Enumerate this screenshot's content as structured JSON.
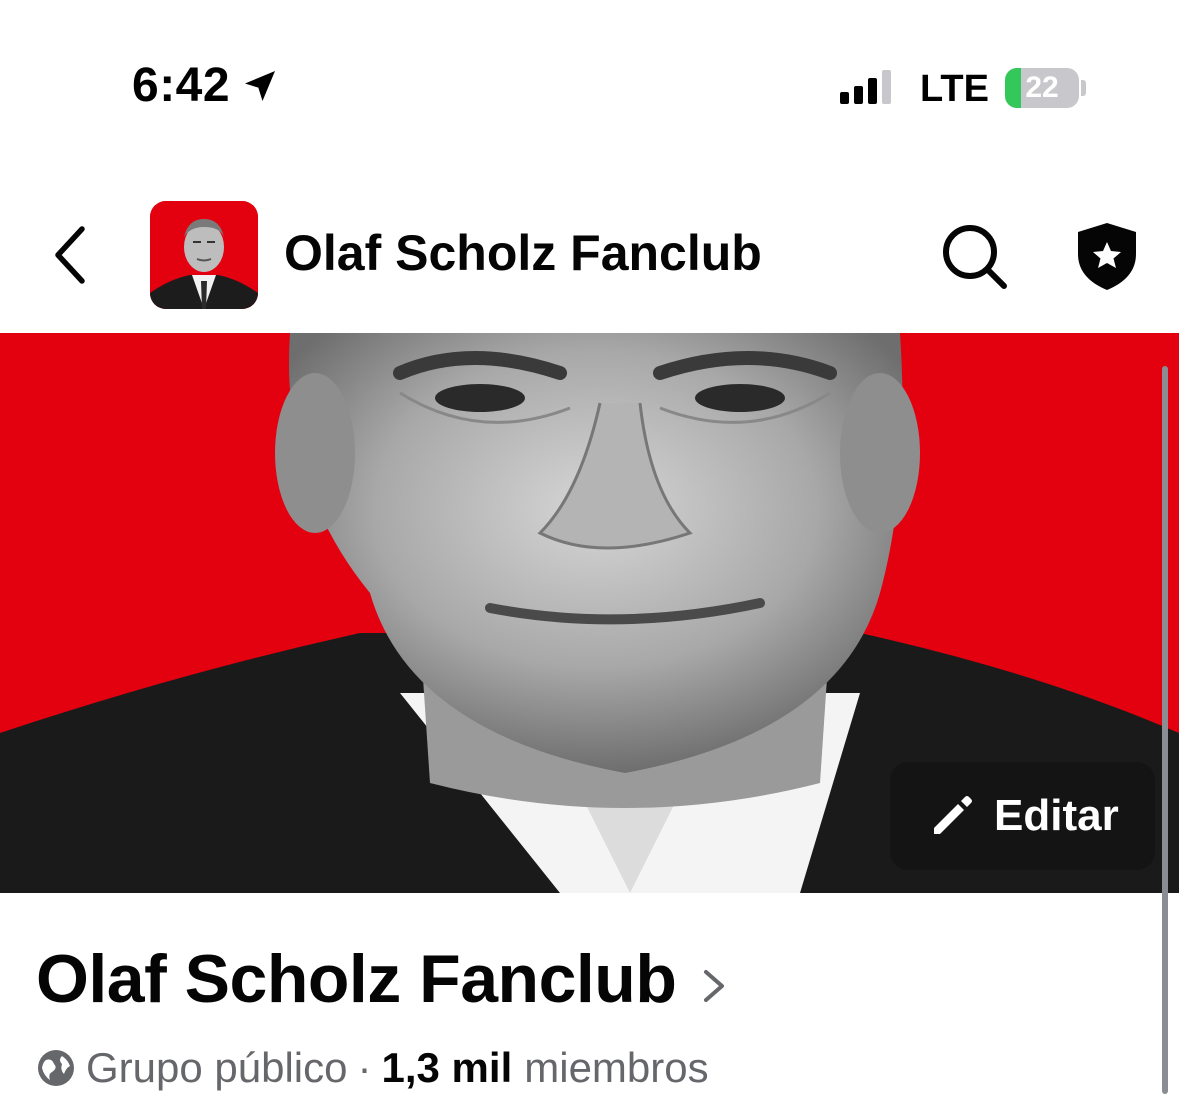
{
  "status_bar": {
    "time": "6:42",
    "network": "LTE",
    "battery_percent": "22",
    "battery_level": 0.22,
    "battery_color": "#34c759"
  },
  "header": {
    "title": "Olaf Scholz Fanclub",
    "back_icon": "chevron-left-icon",
    "search_icon": "search-icon",
    "admin_icon": "shield-star-icon"
  },
  "cover": {
    "background_color": "#e3000f",
    "edit_label": "Editar",
    "edit_icon": "pencil-icon"
  },
  "group": {
    "name": "Olaf Scholz Fanclub",
    "privacy": "Grupo público",
    "separator": "·",
    "member_count": "1,3 mil",
    "member_label": "miembros",
    "privacy_icon": "globe-icon"
  }
}
